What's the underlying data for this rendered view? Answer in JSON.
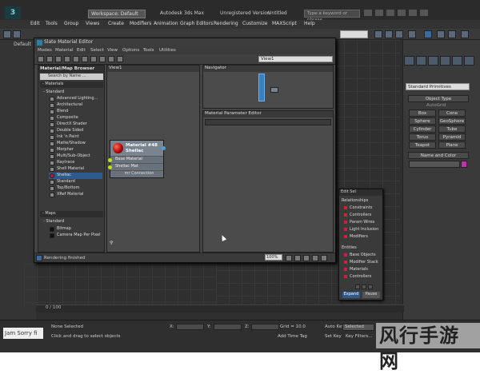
{
  "app": {
    "workspace": "Workspace: Default",
    "app_name": "Autodesk 3ds Max",
    "registration": "Unregistered Version",
    "file": "Untitled",
    "search_placeholder": "Type a keyword or phrase",
    "default_label": "Default"
  },
  "menu": [
    "Edit",
    "Tools",
    "Group",
    "Views",
    "Create",
    "Modifiers",
    "Animation",
    "Graph Editors",
    "Rendering",
    "Customize",
    "MAXScript",
    "Help"
  ],
  "slate": {
    "title": "Slate Material Editor",
    "menu": [
      "Modes",
      "Material",
      "Edit",
      "Select",
      "View",
      "Options",
      "Tools",
      "Utilities"
    ],
    "view_dropdown": "View1",
    "browser": {
      "header": "Material/Map Browser",
      "search": "Search by Name ...",
      "materials_header": "- Materials",
      "standard_header": "- Standard",
      "materials": [
        "Advanced Lighting...",
        "Architectural",
        "Blend",
        "Composite",
        "DirectX Shader",
        "Double Sided",
        "Ink 'n Paint",
        "Matte/Shadow",
        "Morpher",
        "Multi/Sub-Object",
        "Raytrace",
        "Shell Material",
        "Shellac",
        "Standard",
        "Top/Bottom",
        "XRef Material"
      ],
      "maps_header": "- Maps",
      "maps_standard": "- Standard",
      "maps": [
        "Bitmap",
        "Camera Map Per Pixel"
      ]
    },
    "view1_label": "View1",
    "navigator_label": "Navigator",
    "params_label": "Material Parameter Editor",
    "node": {
      "name": "Material #48",
      "type": "Shellac",
      "slots": [
        "Base Material",
        "Shellac Mat",
        "mr Connection"
      ]
    },
    "status": "Rendering finished",
    "zoom": "100%"
  },
  "command_panel": {
    "dropdown": "Standard Primitives",
    "object_type_header": "Object Type",
    "autogrid": "AutoGrid",
    "objects": [
      "Box",
      "Cone",
      "Sphere",
      "GeoSphere",
      "Cylinder",
      "Tube",
      "Torus",
      "Pyramid",
      "Teapot",
      "Plane"
    ],
    "name_color_header": "Name and Color",
    "color": "#c230b2"
  },
  "explorer_popup": {
    "top": "Edit Sel",
    "relationships": "Relationships",
    "rel_items": [
      "Constraints",
      "Controllers",
      "Param Wires",
      "Light Inclusion",
      "Modifiers"
    ],
    "entities": "Entities",
    "ent_items": [
      "Base Objects",
      "Modifier Stack",
      "Materials",
      "Controllers"
    ],
    "expand": "Expand",
    "pause": "Pause"
  },
  "bottom": {
    "frame": "0 / 100",
    "status1": "None Selected",
    "status2": "Click and drag to select objects",
    "sorry": "Jam Sorry fi",
    "x_label": "X:",
    "y_label": "Y:",
    "z_label": "Z:",
    "grid": "Grid = 10.0",
    "autokey": "Auto Key",
    "selected": "Selected",
    "add_time_tag": "Add Time Tag",
    "set_key": "Set Key",
    "key_filters": "Key Filters...",
    "watermark": "风行手游网"
  }
}
